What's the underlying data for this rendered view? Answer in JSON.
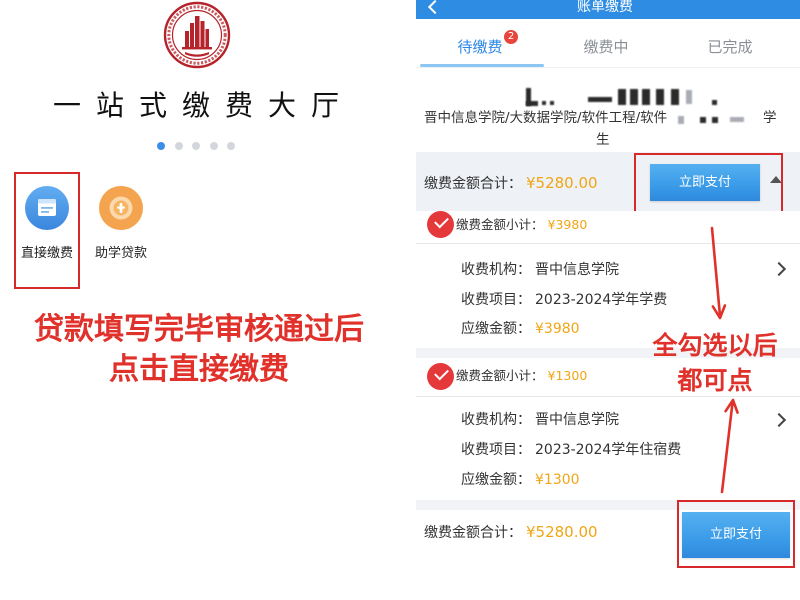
{
  "left": {
    "title": "一站式缴费大厅",
    "carousel": {
      "pages": 5,
      "active": 0
    },
    "shortcuts": [
      {
        "label": "直接缴费",
        "icon": "bill-payment-icon",
        "color": "#3f8fe6"
      },
      {
        "label": "助学贷款",
        "icon": "student-loan-icon",
        "color": "#f3a24b"
      }
    ],
    "annotation": [
      "贷款填写完毕审核通过后",
      "点击直接缴费"
    ]
  },
  "right": {
    "header": {
      "title": "账单缴费",
      "back_icon": "chevron-left-icon"
    },
    "tabs": [
      {
        "label": "待缴费",
        "badge": "2",
        "active": true
      },
      {
        "label": "缴费中",
        "active": false
      },
      {
        "label": "已完成",
        "active": false
      }
    ],
    "student": {
      "affiliation": "晋中信息学院/大数据学院/软件工程/软件",
      "role_part1": "学",
      "role_part2": "生"
    },
    "total_top": {
      "label": "缴费金额合计：",
      "amount": "¥5280.00",
      "button": "立即支付",
      "collapse_icon": "triangle-up-icon"
    },
    "bills": [
      {
        "checked": true,
        "subtotal_label": "缴费金额小计：",
        "subtotal": "¥3980",
        "fields": [
          {
            "label": "收费机构：",
            "value": "晋中信息学院"
          },
          {
            "label": "收费项目：",
            "value": "2023-2024学年学费"
          },
          {
            "label": "应缴金额：",
            "value": "¥3980"
          }
        ]
      },
      {
        "checked": true,
        "subtotal_label": "缴费金额小计：",
        "subtotal": "¥1300",
        "fields": [
          {
            "label": "收费机构：",
            "value": "晋中信息学院"
          },
          {
            "label": "收费项目：",
            "value": "2023-2024学年住宿费"
          },
          {
            "label": "应缴金额：",
            "value": "¥1300"
          }
        ]
      }
    ],
    "row_icon": "chevron-right-icon",
    "total_bottom": {
      "label": "缴费金额合计：",
      "amount": "¥5280.00",
      "button": "立即支付"
    },
    "annotation": [
      "全勾选以后",
      "都可点"
    ]
  },
  "colors": {
    "header_blue": "#2f8ce3",
    "button_blue": "#3a9be8",
    "amount_orange": "#f0a515",
    "annotation_red": "#e0312b",
    "check_red": "#e5383b",
    "seal_red": "#b5232b"
  }
}
